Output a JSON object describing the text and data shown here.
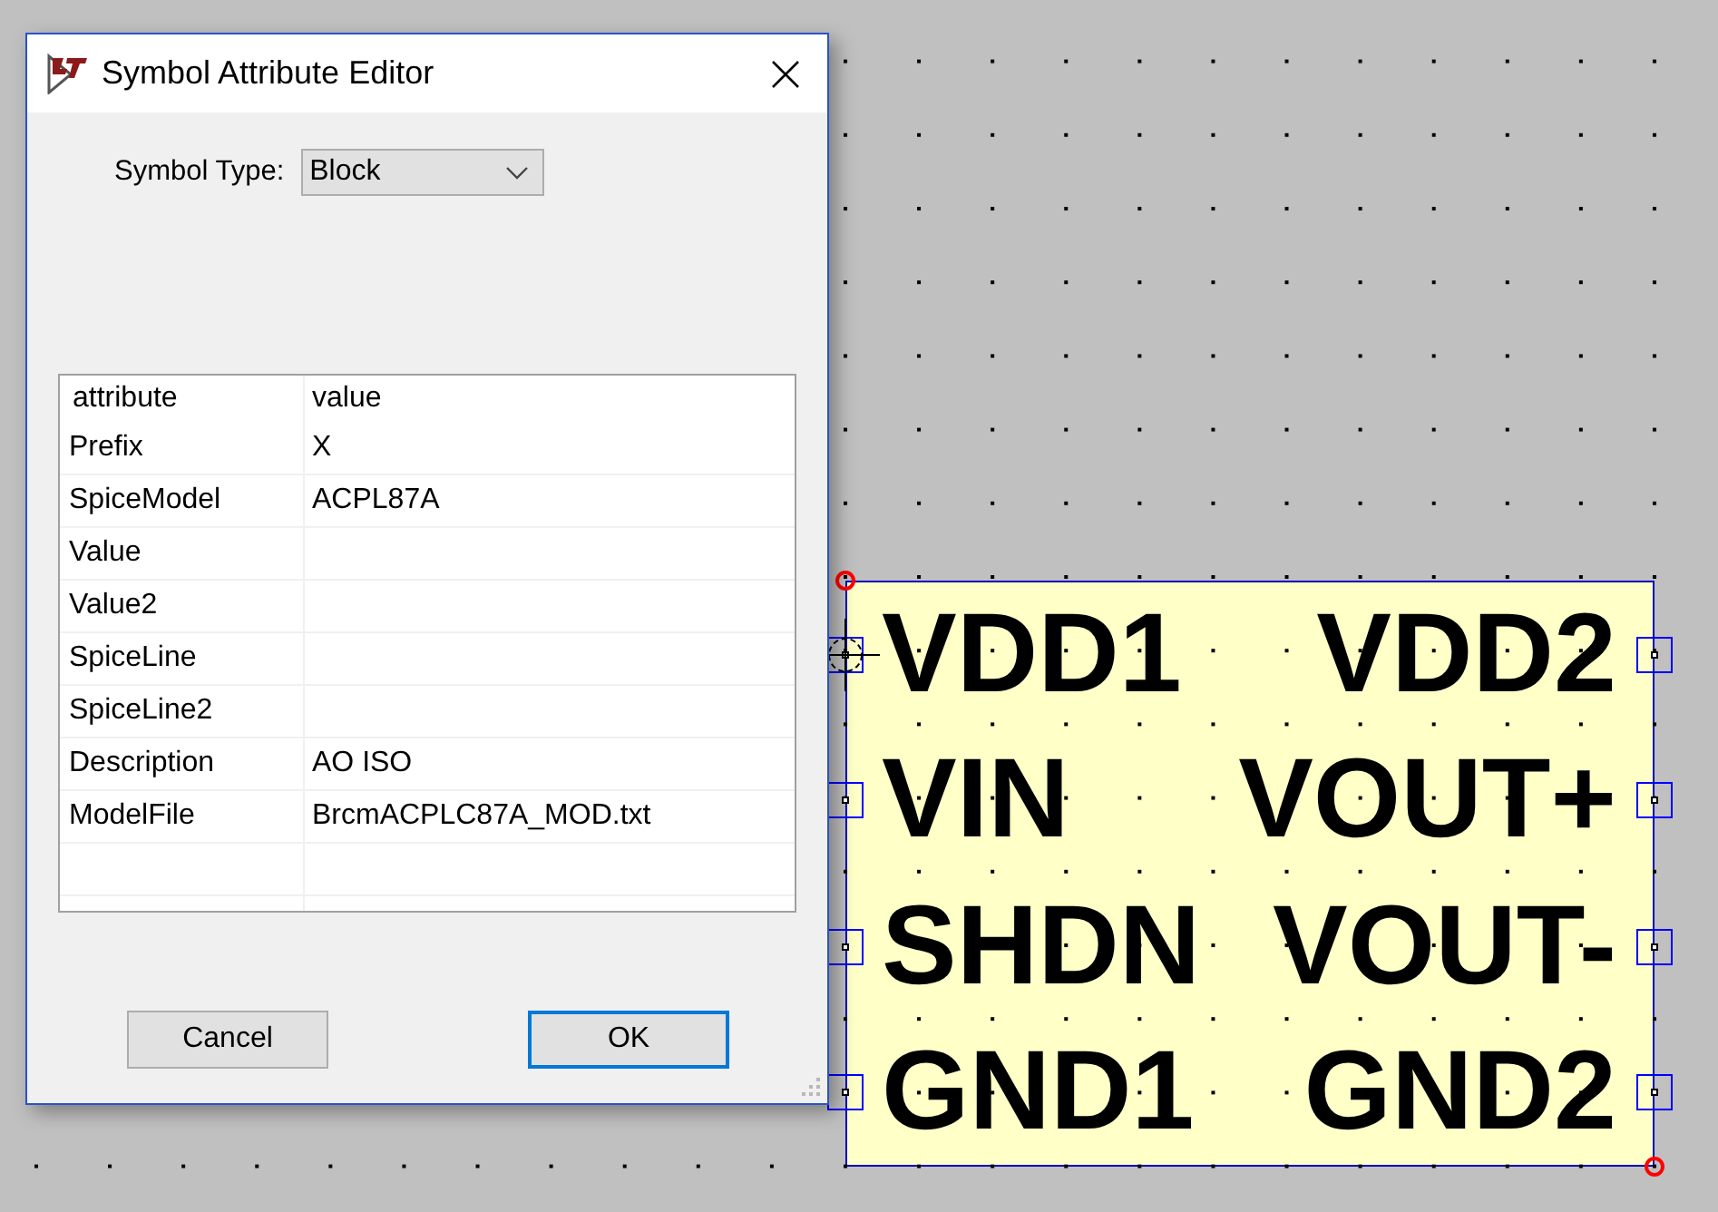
{
  "dialog": {
    "title": "Symbol Attribute Editor",
    "symbol_type": {
      "label": "Symbol Type:",
      "value": "Block"
    },
    "table": {
      "columns": [
        "attribute",
        "value"
      ],
      "rows": [
        {
          "attribute": "Prefix",
          "value": "X"
        },
        {
          "attribute": "SpiceModel",
          "value": "ACPL87A"
        },
        {
          "attribute": "Value"
        },
        {
          "attribute": "Value2"
        },
        {
          "attribute": "SpiceLine"
        },
        {
          "attribute": "SpiceLine2"
        },
        {
          "attribute": "Description",
          "value": "AO ISO"
        },
        {
          "attribute": "ModelFile",
          "value": "BrcmACPLC87A_MOD.txt"
        }
      ]
    },
    "buttons": [
      {
        "label": "Cancel",
        "focused": false
      },
      {
        "label": "OK",
        "focused": true
      }
    ]
  },
  "symbol": {
    "pin_rows": [
      {
        "left": "VDD1",
        "right": "VDD2",
        "cursor": true
      },
      {
        "left": "VIN",
        "right": "VOUT+",
        "cursor": false
      },
      {
        "left": "SHDN",
        "right": "VOUT-",
        "cursor": false
      },
      {
        "left": "GND1",
        "right": "GND2",
        "cursor": false
      }
    ]
  }
}
